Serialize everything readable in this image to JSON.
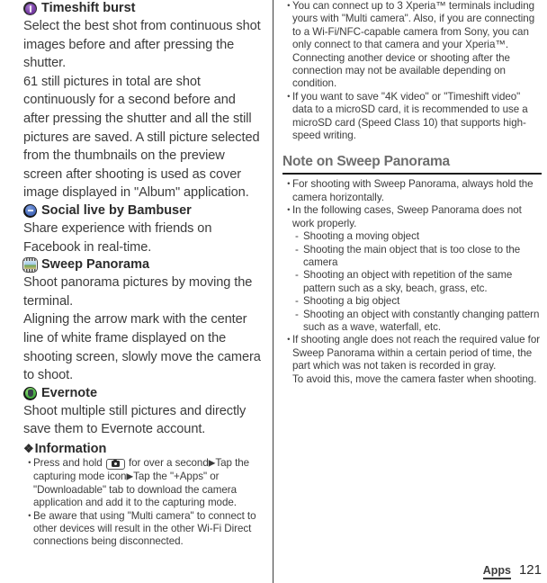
{
  "page": {
    "number": "121",
    "section_tab": "Apps"
  },
  "left_column": {
    "features": [
      {
        "icon": "timeshift-burst-icon",
        "title": "Timeshift burst",
        "paragraphs": [
          "Select the best shot from continuous shot images before and after pressing the shutter.",
          "61 still pictures in total are shot continuously for a second before and after pressing the shutter and all the still pictures are saved. A still picture selected from the thumbnails on the preview screen after shooting is used as cover image displayed in \"Album\" application."
        ]
      },
      {
        "icon": "social-live-bambuser-icon",
        "title": "Social live by Bambuser",
        "paragraphs": [
          "Share experience with friends on Facebook in real-time."
        ]
      },
      {
        "icon": "sweep-panorama-icon",
        "title": "Sweep Panorama",
        "paragraphs": [
          "Shoot panorama pictures by moving the terminal.",
          "Aligning the arrow mark with the center line of white frame displayed on the shooting screen, slowly move the camera to shoot."
        ]
      },
      {
        "icon": "evernote-icon",
        "title": "Evernote",
        "paragraphs": [
          "Shoot multiple still pictures and directly save them to Evernote account."
        ]
      }
    ],
    "information": {
      "diamond": "❖",
      "heading": "Information",
      "items": [
        {
          "bullet": "・",
          "pre_key_text": "Press and hold ",
          "key_icon": "camera-key-icon",
          "post_key_text": " for over a second",
          "arrow1": "▶",
          "mid_text": "Tap the capturing mode icon",
          "arrow2": "▶",
          "tail_text": "Tap the \"+Apps\" or \"Downloadable\" tab to download the camera application and add it to the capturing mode."
        },
        {
          "bullet": "・",
          "text": "Be aware that using \"Multi camera\" to connect to other devices will result in the other Wi-Fi Direct connections being disconnected."
        }
      ]
    }
  },
  "right_column": {
    "top_items": [
      {
        "bullet": "・",
        "text": "You can connect up to 3 Xperia™ terminals including yours with \"Multi camera\". Also, if you are connecting to a Wi-Fi/NFC-capable camera from Sony, you can only connect to that camera and your Xperia™. Connecting another device or shooting after the connection may not be available depending on condition."
      },
      {
        "bullet": "・",
        "text": "If you want to save \"4K video\" or \"Timeshift video\" data to a microSD card, it is recommended to use a microSD card (Speed Class 10) that supports high-speed writing."
      }
    ],
    "section": {
      "heading": "Note on Sweep Panorama",
      "items": [
        {
          "bullet": "・",
          "text": "For shooting with Sweep Panorama, always hold the camera horizontally."
        },
        {
          "bullet": "・",
          "text": "In the following cases, Sweep Panorama does not work properly.",
          "sub_items": [
            {
              "dash": "-",
              "text": "Shooting a moving object"
            },
            {
              "dash": "-",
              "text": "Shooting the main object that is too close to the camera"
            },
            {
              "dash": "-",
              "text": "Shooting an object with repetition of the same pattern such as a sky, beach, grass, etc."
            },
            {
              "dash": "-",
              "text": "Shooting a big object"
            },
            {
              "dash": "-",
              "text": "Shooting an object with constantly changing pattern such as a wave, waterfall, etc."
            }
          ]
        },
        {
          "bullet": "・",
          "text": "If shooting angle does not reach the required value for Sweep Panorama within a certain period of time, the part which was not taken is recorded in gray.",
          "extra_line": "To avoid this, move the camera faster when shooting."
        }
      ]
    }
  }
}
